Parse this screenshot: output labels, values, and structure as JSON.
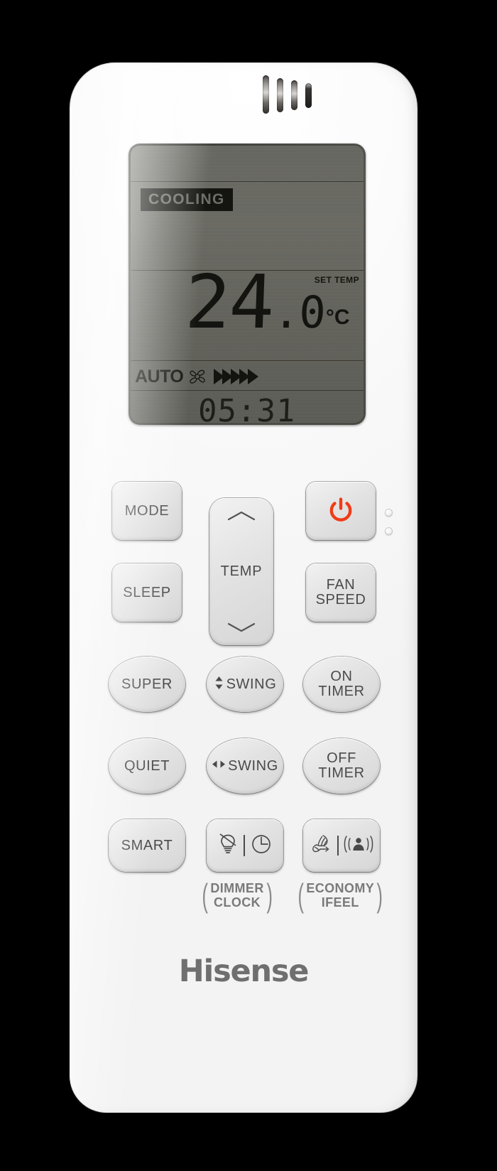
{
  "device": {
    "brand": "Hisense",
    "type": "air-conditioner-remote"
  },
  "display": {
    "mode_label": "COOLING",
    "set_temp_label": "SET TEMP",
    "temperature_integer": "24",
    "temperature_fraction": ".0",
    "temperature_unit": "°C",
    "fan_speed_label": "AUTO",
    "fan_icon": "fan-blade-icon",
    "fan_chevron_count": 5,
    "clock_value": "05:31"
  },
  "buttons": {
    "mode": "MODE",
    "sleep": "SLEEP",
    "power_icon": "power-icon",
    "power_color": "#f03c18",
    "fan_speed_line1": "FAN",
    "fan_speed_line2": "SPEED",
    "temp_label": "TEMP",
    "temp_up_icon": "chevron-up-icon",
    "temp_down_icon": "chevron-down-icon",
    "super": "SUPER",
    "swing_vertical": "SWING",
    "swing_vertical_icon": "arrow-up-down-icon",
    "on_timer_line1": "ON",
    "on_timer_line2": "TIMER",
    "quiet": "QUIET",
    "swing_horizontal": "SWING",
    "swing_horizontal_icon": "arrow-left-right-icon",
    "off_timer_line1": "OFF",
    "off_timer_line2": "TIMER",
    "smart": "SMART",
    "dimmer_icon": "bulb-off-icon",
    "clock_icon": "clock-icon",
    "economy_icon": "economy-leaf-icon",
    "ifeel_icon": "person-signal-icon"
  },
  "captions": {
    "dimmer_line1": "DIMMER",
    "dimmer_line2": "CLOCK",
    "economy_line1": "ECONOMY",
    "economy_line2": "IFEEL",
    "bracket_left": "(",
    "bracket_right": ")"
  },
  "colors": {
    "body": "#fafafa",
    "button": "#e3e3e3",
    "lcd": "#65655e",
    "lcd_text": "#141410",
    "brand_gray": "#6f6f6f",
    "power_red": "#f03c18"
  }
}
